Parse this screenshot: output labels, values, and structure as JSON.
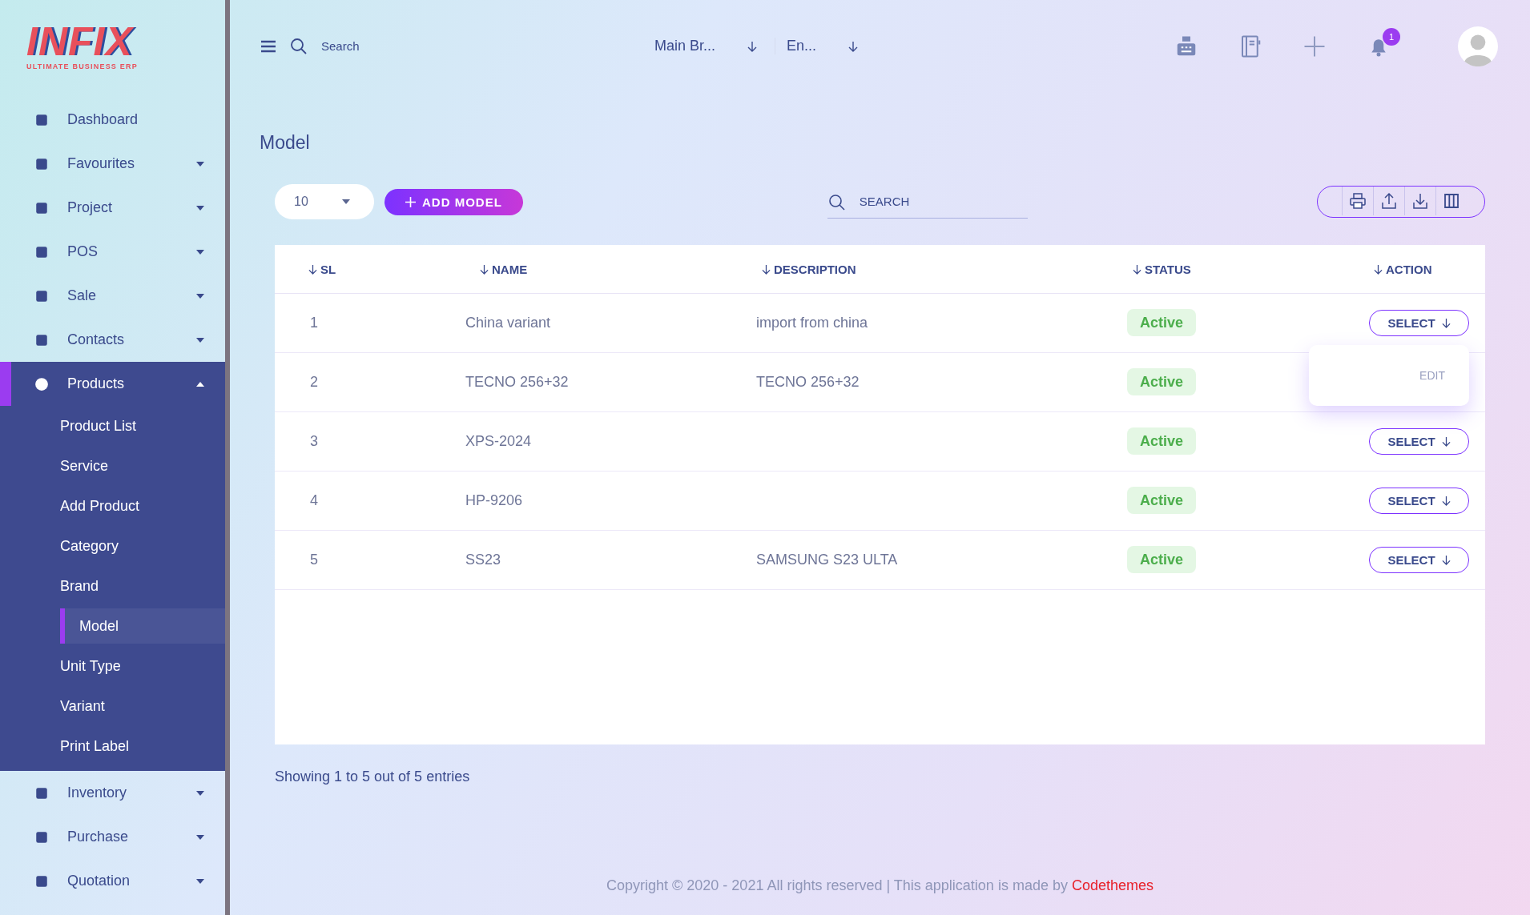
{
  "logo": {
    "name": "INFIX",
    "tagline": "ULTIMATE BUSINESS ERP"
  },
  "topbar": {
    "search_placeholder": "Search",
    "branch": "Main Br...",
    "language": "En...",
    "notifications": "1"
  },
  "sidebar": {
    "items": [
      {
        "label": "Dashboard",
        "has_caret": false,
        "selected": false
      },
      {
        "label": "Favourites",
        "has_caret": true,
        "expanded": false,
        "selected": false
      },
      {
        "label": "Project",
        "has_caret": true,
        "expanded": false,
        "selected": false
      },
      {
        "label": "POS",
        "has_caret": true,
        "expanded": false,
        "selected": false
      },
      {
        "label": "Sale",
        "has_caret": true,
        "expanded": false,
        "selected": false
      },
      {
        "label": "Contacts",
        "has_caret": true,
        "expanded": false,
        "selected": false
      },
      {
        "label": "Products",
        "has_caret": true,
        "expanded": true,
        "selected": true,
        "children": [
          {
            "label": "Product List",
            "selected": false
          },
          {
            "label": "Service",
            "selected": false
          },
          {
            "label": "Add Product",
            "selected": false
          },
          {
            "label": "Category",
            "selected": false
          },
          {
            "label": "Brand",
            "selected": false
          },
          {
            "label": "Model",
            "selected": true
          },
          {
            "label": "Unit Type",
            "selected": false
          },
          {
            "label": "Variant",
            "selected": false
          },
          {
            "label": "Print Label",
            "selected": false
          }
        ]
      },
      {
        "label": "Inventory",
        "has_caret": true,
        "expanded": false,
        "selected": false
      },
      {
        "label": "Purchase",
        "has_caret": true,
        "expanded": false,
        "selected": false
      },
      {
        "label": "Quotation",
        "has_caret": true,
        "expanded": false,
        "selected": false
      }
    ]
  },
  "page": {
    "title": "Model",
    "page_size": "10",
    "add_button": "ADD MODEL",
    "search_placeholder": "SEARCH"
  },
  "table": {
    "columns": [
      "SL",
      "NAME",
      "DESCRIPTION",
      "STATUS",
      "ACTION"
    ],
    "rows": [
      {
        "sl": "1",
        "name": "China variant",
        "description": "import from china",
        "status": "Active",
        "action": "SELECT",
        "menu": [
          "EDIT"
        ]
      },
      {
        "sl": "2",
        "name": "TECNO 256+32",
        "description": "TECNO 256+32",
        "status": "Active"
      },
      {
        "sl": "3",
        "name": "XPS-2024",
        "status": "Active",
        "action": "SELECT"
      },
      {
        "sl": "4",
        "name": "HP-9206",
        "status": "Active",
        "action": "SELECT"
      },
      {
        "sl": "5",
        "name": "SS23",
        "description": "SAMSUNG S23 ULTA",
        "status": "Active",
        "action": "SELECT"
      }
    ]
  },
  "footer": {
    "entries": "Showing 1 to 5 out of 5 entries",
    "copyright": "Copyright © 2020 - 2021 All rights reserved | This application is made by",
    "link": "Codethemes"
  }
}
